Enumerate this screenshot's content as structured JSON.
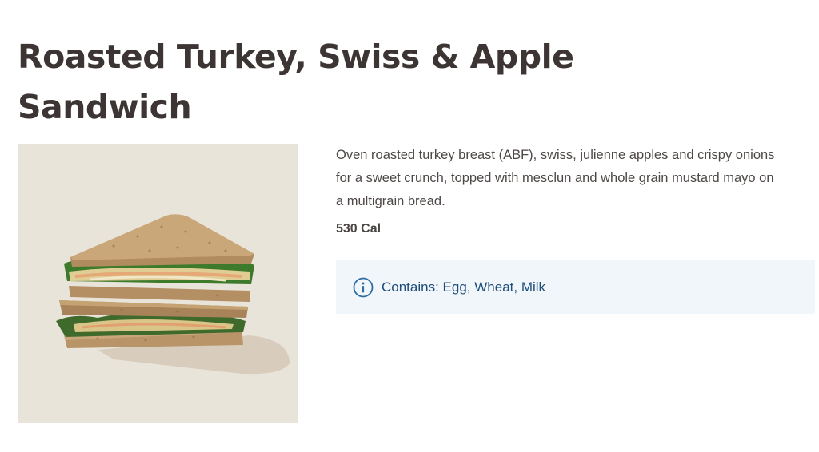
{
  "product": {
    "title": "Roasted Turkey, Swiss & Apple Sandwich",
    "description": "Oven roasted turkey breast (ABF), swiss, julienne apples and crispy onions for a sweet crunch, topped with mesclun and whole grain mustard mayo on a multigrain bread.",
    "calories": "530 Cal",
    "allergens": "Contains: Egg, Wheat, Milk",
    "image_alt": "Roasted Turkey, Swiss & Apple Sandwich"
  },
  "icons": {
    "allergen_icon": "info-icon"
  },
  "colors": {
    "title": "#3c3534",
    "allergen_text": "#1f4d7a",
    "allergen_background": "#f1f6fa",
    "image_background": "#e9e4da"
  }
}
